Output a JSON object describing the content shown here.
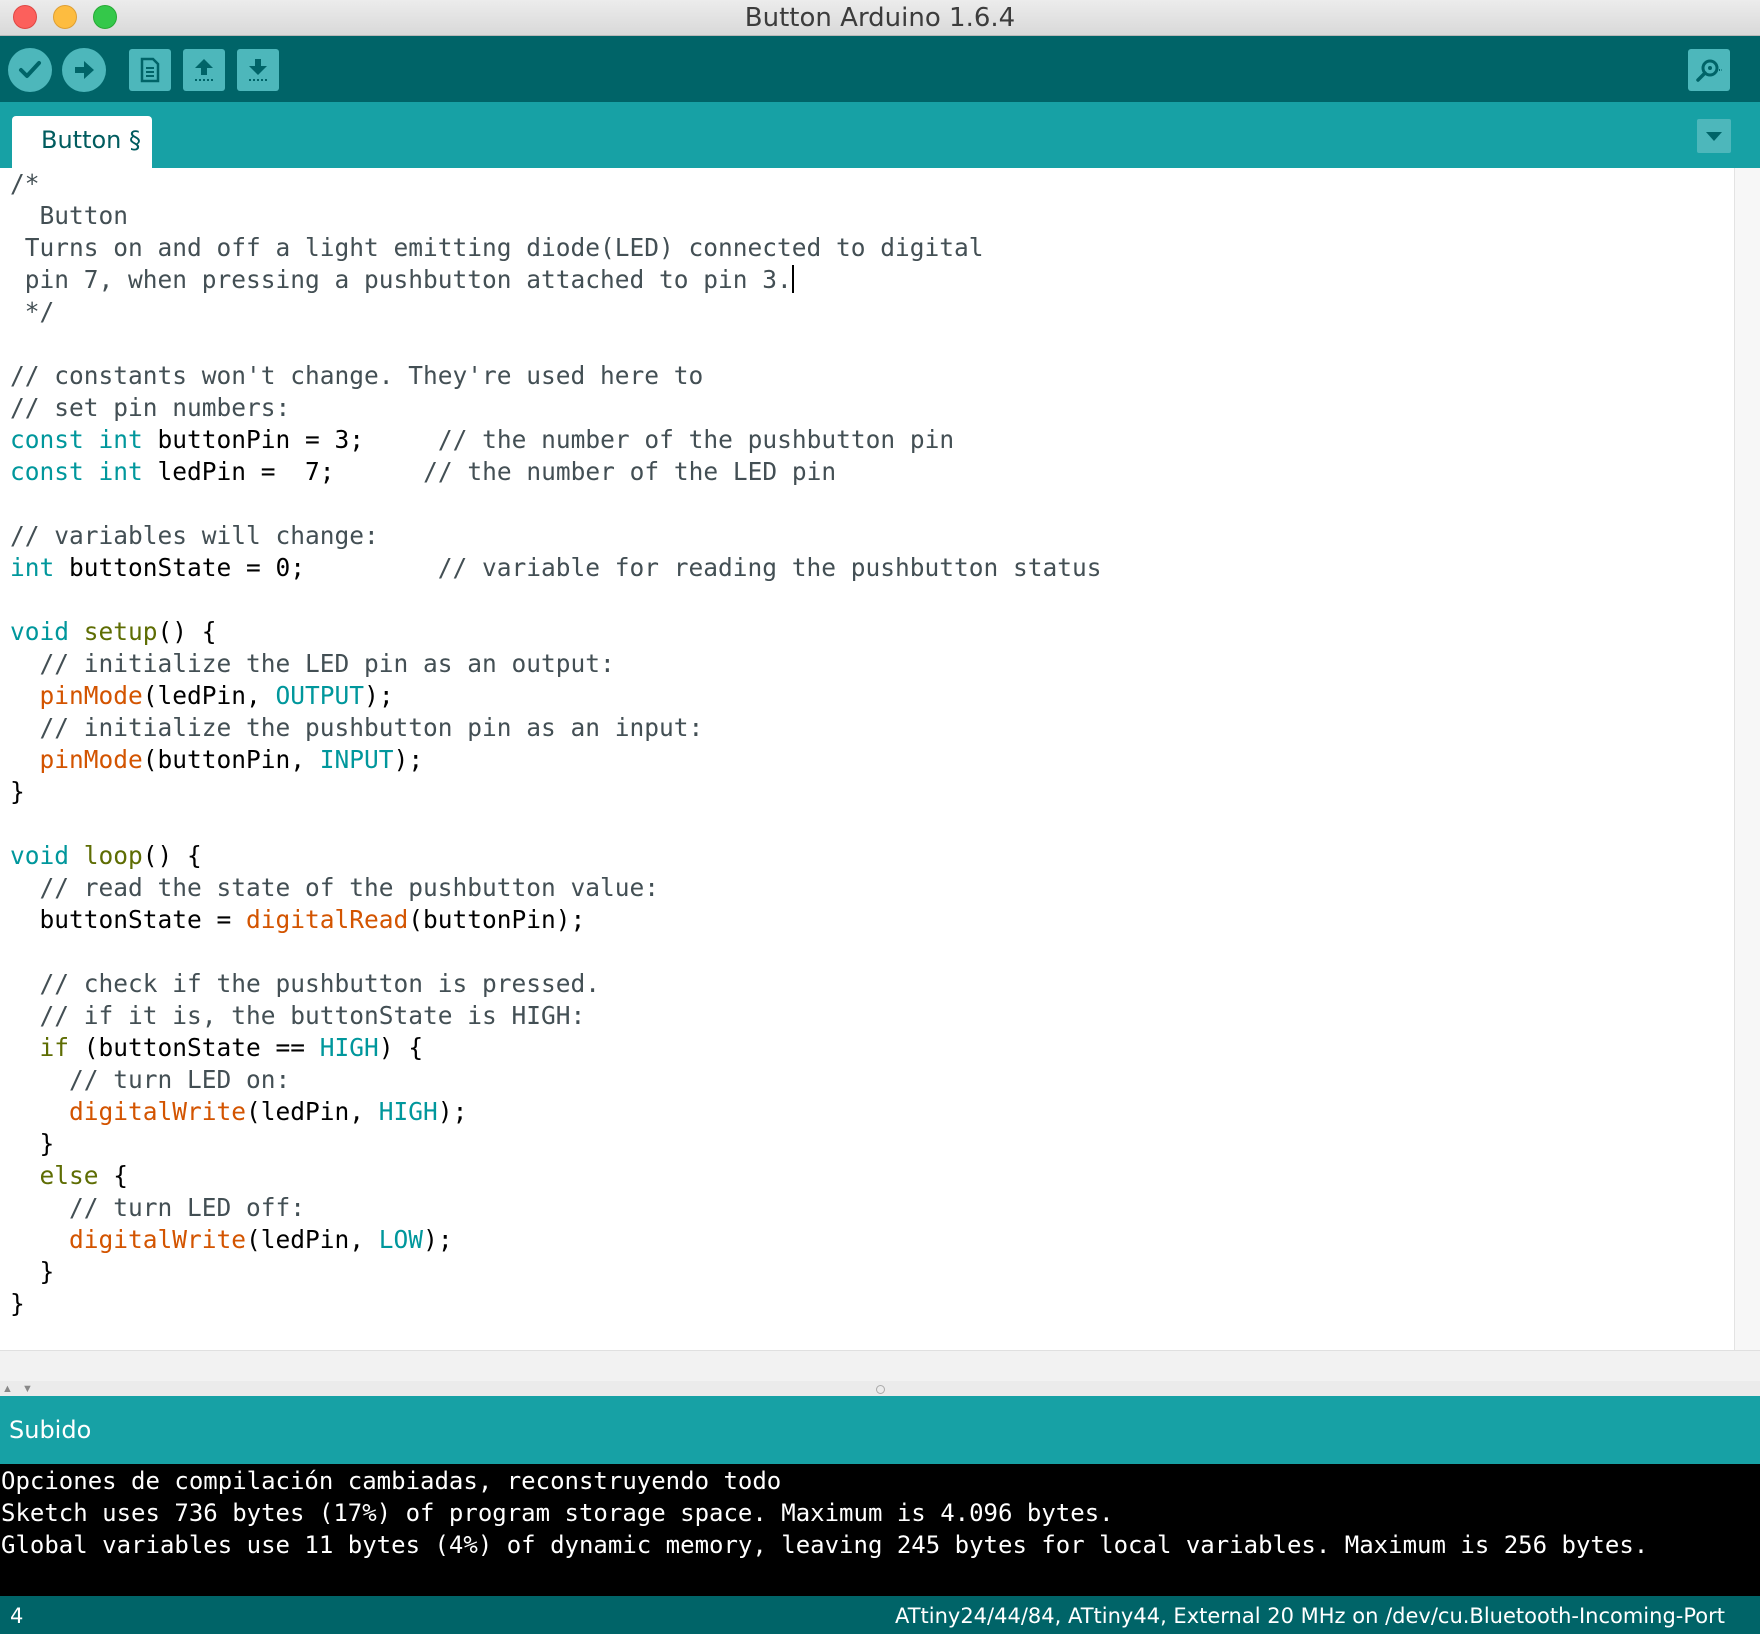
{
  "window": {
    "title": "Button Arduino 1.6.4"
  },
  "toolbar": {
    "verify_icon": "checkmark-icon",
    "upload_icon": "arrow-right-icon",
    "new_icon": "document-icon",
    "open_icon": "arrow-up-icon",
    "save_icon": "arrow-down-icon",
    "monitor_icon": "magnifier-icon"
  },
  "tabs": [
    {
      "label": "Button §"
    }
  ],
  "editor": {
    "caret_line": 4,
    "lines": [
      [
        [
          "c",
          "/*"
        ]
      ],
      [
        [
          "c",
          "  Button"
        ]
      ],
      [
        [
          "c",
          " Turns on and off a light emitting diode(LED) connected to digital"
        ]
      ],
      [
        [
          "c",
          " pin 7, when pressing a pushbutton attached to pin 3."
        ]
      ],
      [
        [
          "c",
          " */"
        ]
      ],
      [],
      [
        [
          "c",
          "// constants won't change. They're used here to"
        ]
      ],
      [
        [
          "c",
          "// set pin numbers:"
        ]
      ],
      [
        [
          "t",
          "const"
        ],
        [
          "p",
          " "
        ],
        [
          "t",
          "int"
        ],
        [
          "p",
          " buttonPin = 3;     "
        ],
        [
          "c",
          "// the number of the pushbutton pin"
        ]
      ],
      [
        [
          "t",
          "const"
        ],
        [
          "p",
          " "
        ],
        [
          "t",
          "int"
        ],
        [
          "p",
          " ledPin =  7;      "
        ],
        [
          "c",
          "// the number of the LED pin"
        ]
      ],
      [],
      [
        [
          "c",
          "// variables will change:"
        ]
      ],
      [
        [
          "t",
          "int"
        ],
        [
          "p",
          " buttonState = 0;         "
        ],
        [
          "c",
          "// variable for reading the pushbutton status"
        ]
      ],
      [],
      [
        [
          "t",
          "void"
        ],
        [
          "p",
          " "
        ],
        [
          "k",
          "setup"
        ],
        [
          "p",
          "() {"
        ]
      ],
      [
        [
          "p",
          "  "
        ],
        [
          "c",
          "// initialize the LED pin as an output:"
        ]
      ],
      [
        [
          "p",
          "  "
        ],
        [
          "f",
          "pinMode"
        ],
        [
          "p",
          "(ledPin, "
        ],
        [
          "t",
          "OUTPUT"
        ],
        [
          "p",
          ");"
        ]
      ],
      [
        [
          "p",
          "  "
        ],
        [
          "c",
          "// initialize the pushbutton pin as an input:"
        ]
      ],
      [
        [
          "p",
          "  "
        ],
        [
          "f",
          "pinMode"
        ],
        [
          "p",
          "(buttonPin, "
        ],
        [
          "t",
          "INPUT"
        ],
        [
          "p",
          ");"
        ]
      ],
      [
        [
          "p",
          "}"
        ]
      ],
      [],
      [
        [
          "t",
          "void"
        ],
        [
          "p",
          " "
        ],
        [
          "k",
          "loop"
        ],
        [
          "p",
          "() {"
        ]
      ],
      [
        [
          "p",
          "  "
        ],
        [
          "c",
          "// read the state of the pushbutton value:"
        ]
      ],
      [
        [
          "p",
          "  buttonState = "
        ],
        [
          "f",
          "digitalRead"
        ],
        [
          "p",
          "(buttonPin);"
        ]
      ],
      [],
      [
        [
          "p",
          "  "
        ],
        [
          "c",
          "// check if the pushbutton is pressed."
        ]
      ],
      [
        [
          "p",
          "  "
        ],
        [
          "c",
          "// if it is, the buttonState is HIGH:"
        ]
      ],
      [
        [
          "p",
          "  "
        ],
        [
          "k",
          "if"
        ],
        [
          "p",
          " (buttonState == "
        ],
        [
          "t",
          "HIGH"
        ],
        [
          "p",
          ") {"
        ]
      ],
      [
        [
          "p",
          "    "
        ],
        [
          "c",
          "// turn LED on:"
        ]
      ],
      [
        [
          "p",
          "    "
        ],
        [
          "f",
          "digitalWrite"
        ],
        [
          "p",
          "(ledPin, "
        ],
        [
          "t",
          "HIGH"
        ],
        [
          "p",
          ");"
        ]
      ],
      [
        [
          "p",
          "  }"
        ]
      ],
      [
        [
          "p",
          "  "
        ],
        [
          "k",
          "else"
        ],
        [
          "p",
          " {"
        ]
      ],
      [
        [
          "p",
          "    "
        ],
        [
          "c",
          "// turn LED off:"
        ]
      ],
      [
        [
          "p",
          "    "
        ],
        [
          "f",
          "digitalWrite"
        ],
        [
          "p",
          "(ledPin, "
        ],
        [
          "t",
          "LOW"
        ],
        [
          "p",
          ");"
        ]
      ],
      [
        [
          "p",
          "  }"
        ]
      ],
      [
        [
          "p",
          "}"
        ]
      ]
    ]
  },
  "status": {
    "text": "Subido"
  },
  "console": {
    "lines": [
      "Opciones de compilación cambiadas, reconstruyendo todo",
      "Sketch uses 736 bytes (17%) of program storage space. Maximum is 4.096 bytes.",
      "Global variables use 11 bytes (4%) of dynamic memory, leaving 245 bytes for local variables. Maximum is 256 bytes."
    ]
  },
  "footer": {
    "line_number": "4",
    "board": "ATtiny24/44/84, ATtiny44, External 20 MHz on /dev/cu.Bluetooth-Incoming-Port"
  },
  "colors": {
    "toolbar": "#006468",
    "tabbar": "#17a1a5",
    "button": "#4db7bb",
    "keyword": "#00979c",
    "function": "#d35400",
    "comment": "#434f54",
    "structure": "#5e6d03"
  }
}
